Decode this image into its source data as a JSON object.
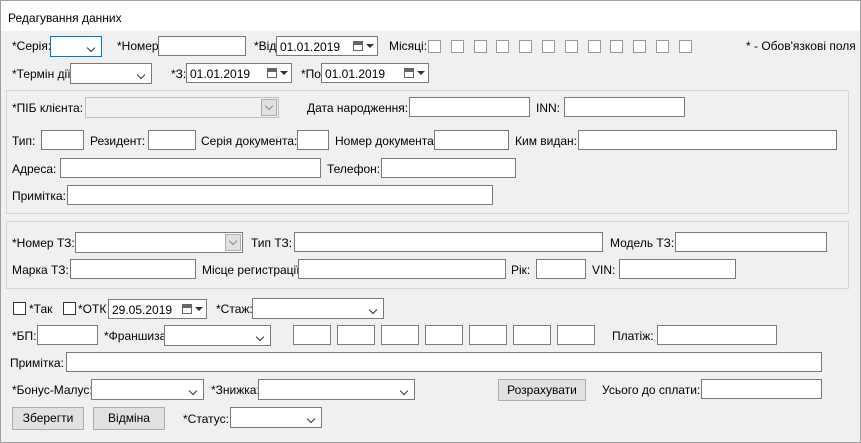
{
  "window": {
    "title": "Редагування данних"
  },
  "row1": {
    "seriya_label": "*Серія:",
    "nomer_label": "*Номер:",
    "nomer_value": "",
    "vid_label": "*Від:",
    "vid_date": "01.01.2019",
    "misyatsi_label": "Місяці:",
    "months_checked": [
      false,
      false,
      false,
      false,
      false,
      false,
      false,
      false,
      false,
      false,
      false,
      false
    ],
    "required_note": "* - Обов'язкові поля"
  },
  "row2": {
    "termin_label": "*Термін дії:",
    "z_label": "*З:",
    "z_date": "01.01.2019",
    "po_label": "*По",
    "po_date": "01.01.2019"
  },
  "client": {
    "pib_label": "*ПІБ клієнта:",
    "birth_label": "Дата народження:",
    "inn_label": "INN:",
    "typ_label": "Тип:",
    "resident_label": "Резидент:",
    "doc_series_label": "Серія документа:",
    "doc_number_label": "Номер документа:",
    "issued_by_label": "Ким видан:",
    "address_label": "Адреса:",
    "phone_label": "Телефон:",
    "note_label": "Примітка:"
  },
  "vehicle": {
    "number_label": "*Номер ТЗ:",
    "type_label": "Тип ТЗ:",
    "model_label": "Модель ТЗ:",
    "make_label": "Марка ТЗ:",
    "reg_place_label": "Місце регистрації:",
    "year_label": "Рік:",
    "vin_label": "VIN:"
  },
  "policy": {
    "tak_label": "*Так",
    "tak_checked": false,
    "otk_label": "*ОТК",
    "otk_checked": false,
    "otk_date": "29.05.2019",
    "stazh_label": "*Стаж:",
    "bp_label": "*БП:",
    "franchise_label": "*Франшиза:",
    "payment_label": "Платіж:",
    "note_label": "Примітка:",
    "bonus_label": "*Бонус-Малус:",
    "discount_label": "*Знижка:",
    "calculate_button": "Розрахувати",
    "total_label": "Усього до сплати:"
  },
  "footer": {
    "save_button": "Зберегти",
    "cancel_button": "Відміна",
    "status_label": "*Статус:"
  }
}
